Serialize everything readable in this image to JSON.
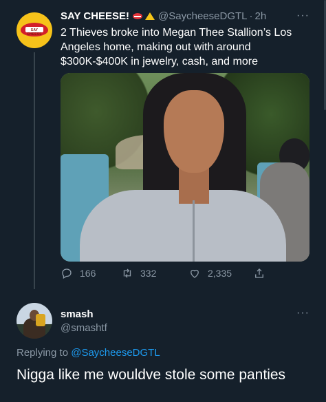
{
  "tweet": {
    "author_name": "SAY CHEESE!",
    "avatar_brand": "SAY CHEESE",
    "handle": "@SaycheeseDGTL",
    "separator": "·",
    "time": "2h",
    "more_label": "···",
    "text": "2 Thieves broke into Megan Thee Stallion’s Los Angeles home, making out with around $300K-$400K in jewelry, cash, and more",
    "stats": {
      "replies": "166",
      "retweets": "332",
      "likes": "2,335"
    }
  },
  "reply": {
    "author_name": "smash",
    "handle": "@smashtf",
    "more_label": "···",
    "replying_prefix": "Replying to",
    "replying_to": "@SaycheeseDGTL",
    "text": "Nigga like me wouldve stole some panties"
  },
  "colors": {
    "background": "#15202b",
    "secondary_text": "#8b98a5",
    "link": "#1d9bf0"
  }
}
